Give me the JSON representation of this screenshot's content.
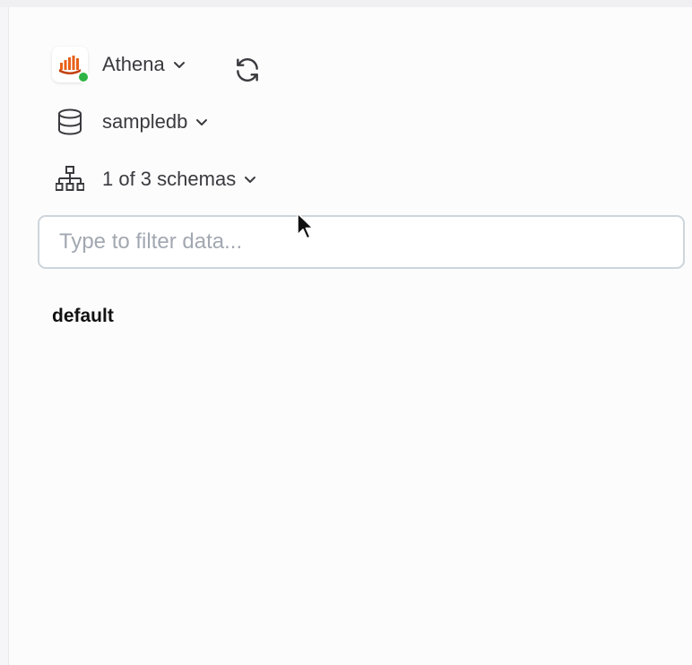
{
  "connection": {
    "name": "Athena",
    "logo_icon": "aws-athena-icon",
    "status": "connected",
    "status_color": "#2fb344",
    "brand_color": "#e8611a"
  },
  "database": {
    "name": "sampledb",
    "icon": "database-icon"
  },
  "schemas": {
    "label": "1 of 3 schemas",
    "icon": "hierarchy-icon"
  },
  "filter": {
    "placeholder": "Type to filter data...",
    "value": ""
  },
  "schema_list": [
    {
      "name": "default"
    }
  ],
  "colors": {
    "text": "#3a3a3f",
    "input_border": "#cdd5db",
    "placeholder": "#a2a8b1",
    "background": "#fcfcfc"
  }
}
